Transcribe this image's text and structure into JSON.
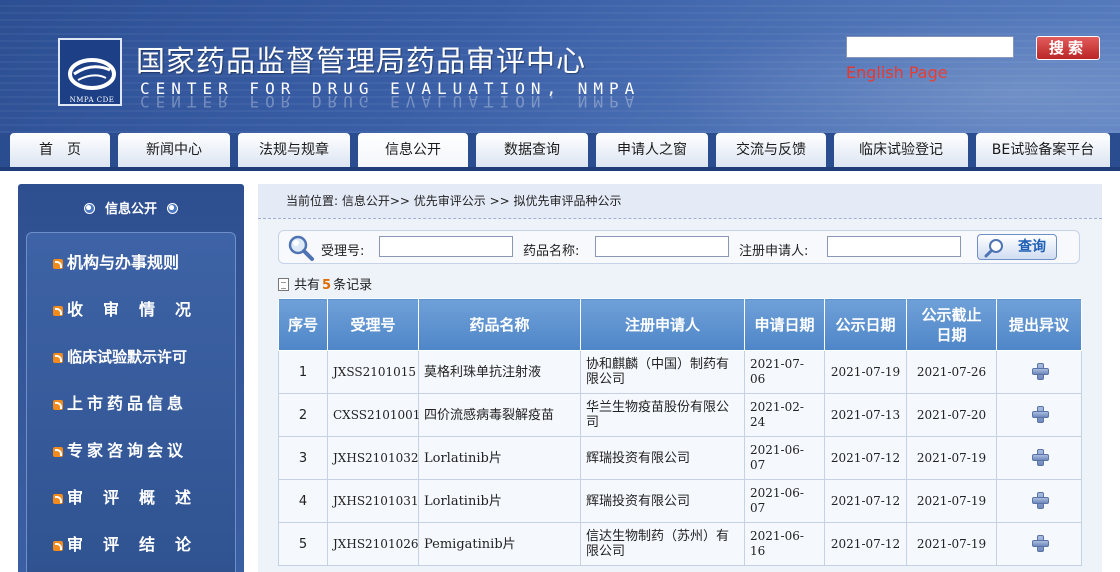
{
  "header": {
    "title_cn": "国家药品监督管理局药品审评中心",
    "title_en": "CENTER FOR DRUG EVALUATION, NMPA",
    "logo_caption": "NMPA CDE",
    "search_value": "",
    "search_button": "搜索",
    "english_link": "English Page"
  },
  "nav": {
    "tabs": [
      "首　页",
      "新闻中心",
      "法规与规章",
      "信息公开",
      "数据查询",
      "申请人之窗",
      "交流与反馈",
      "临床试验登记",
      "BE试验备案平台"
    ],
    "active_index": 3
  },
  "sidebar": {
    "title": "信息公开",
    "items": [
      "机构与办事规则",
      "收审情况",
      "临床试验默示许可",
      "上市药品信息",
      "专家咨询会议",
      "审评概述",
      "审评结论"
    ]
  },
  "breadcrumb": "当前位置:  信息公开>> 优先审评公示 >> 拟优先审评品种公示",
  "search": {
    "label_accept": "受理号:",
    "label_drug": "药品名称:",
    "label_applicant": "注册申请人:",
    "accept_value": "",
    "drug_value": "",
    "applicant_value": "",
    "query_button": "查询"
  },
  "records": {
    "prefix": "共有",
    "count": "5",
    "suffix": "条记录"
  },
  "table": {
    "headers": [
      "序号",
      "受理号",
      "药品名称",
      "注册申请人",
      "申请日期",
      "公示日期",
      "公示截止日期",
      "提出异议"
    ],
    "rows": [
      {
        "no": "1",
        "accept": "JXSS2101015",
        "drug": "莫格利珠单抗注射液",
        "applicant": "协和麒麟（中国）制药有限公司",
        "apply_date": "2021-07-06",
        "pub_date": "2021-07-19",
        "deadline": "2021-07-26"
      },
      {
        "no": "2",
        "accept": "CXSS2101001",
        "drug": "四价流感病毒裂解疫苗",
        "applicant": "华兰生物疫苗股份有限公司",
        "apply_date": "2021-02-24",
        "pub_date": "2021-07-13",
        "deadline": "2021-07-20"
      },
      {
        "no": "3",
        "accept": "JXHS2101032",
        "drug": "Lorlatinib片",
        "applicant": "辉瑞投资有限公司",
        "apply_date": "2021-06-07",
        "pub_date": "2021-07-12",
        "deadline": "2021-07-19"
      },
      {
        "no": "4",
        "accept": "JXHS2101031",
        "drug": "Lorlatinib片",
        "applicant": "辉瑞投资有限公司",
        "apply_date": "2021-06-07",
        "pub_date": "2021-07-12",
        "deadline": "2021-07-19"
      },
      {
        "no": "5",
        "accept": "JXHS2101026",
        "drug": "Pemigatinib片",
        "applicant": "信达生物制药（苏州）有限公司",
        "apply_date": "2021-06-16",
        "pub_date": "2021-07-12",
        "deadline": "2021-07-19"
      }
    ]
  },
  "colors": {
    "header_blue": "#3a5ea6",
    "nav_blue": "#2a4d8f",
    "table_header": "#5b8fcc",
    "search_red": "#c41a1a",
    "english_red": "#e8261b",
    "count_orange": "#e06b00"
  }
}
